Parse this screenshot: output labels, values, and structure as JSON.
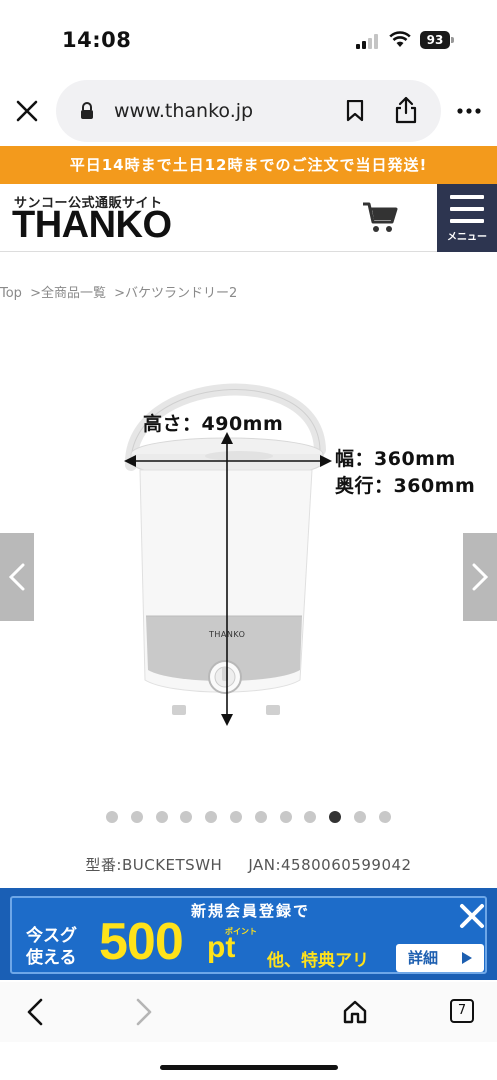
{
  "status_bar": {
    "time": "14:08",
    "battery": "93"
  },
  "browser": {
    "url": "www.thanko.jp"
  },
  "banner": {
    "shipping": "平日14時まで土日12時までのご注文で当日発送!"
  },
  "header": {
    "tagline": "サンコー公式通販サイト",
    "logo": "THANKO",
    "menu_label": "メニュー"
  },
  "breadcrumb": [
    "Top",
    ">全商品一覧",
    ">バケツランドリー2"
  ],
  "product": {
    "height_label": "高さ：490mm",
    "width_label": "幅：360mm",
    "depth_label": "奥行：360mm",
    "brand_mark": "THANKO",
    "carousel": {
      "total": 12,
      "active_index": 9
    },
    "model": "型番:BUCKETSWH",
    "jan": "JAN:4580060599042"
  },
  "promo": {
    "headline": "新規会員登録で",
    "now_line1": "今スグ",
    "now_line2": "使える",
    "points": "500",
    "points_unit": "pt",
    "points_small": "ポイント",
    "extra": "他、特典アリ",
    "detail_button": "詳細"
  },
  "toolbar": {
    "tabs_count": "7"
  },
  "colors": {
    "banner_orange": "#f39a1c",
    "menu_navy": "#2d3550",
    "promo_blue": "#1d6cc9",
    "promo_yellow": "#ffe21a"
  }
}
